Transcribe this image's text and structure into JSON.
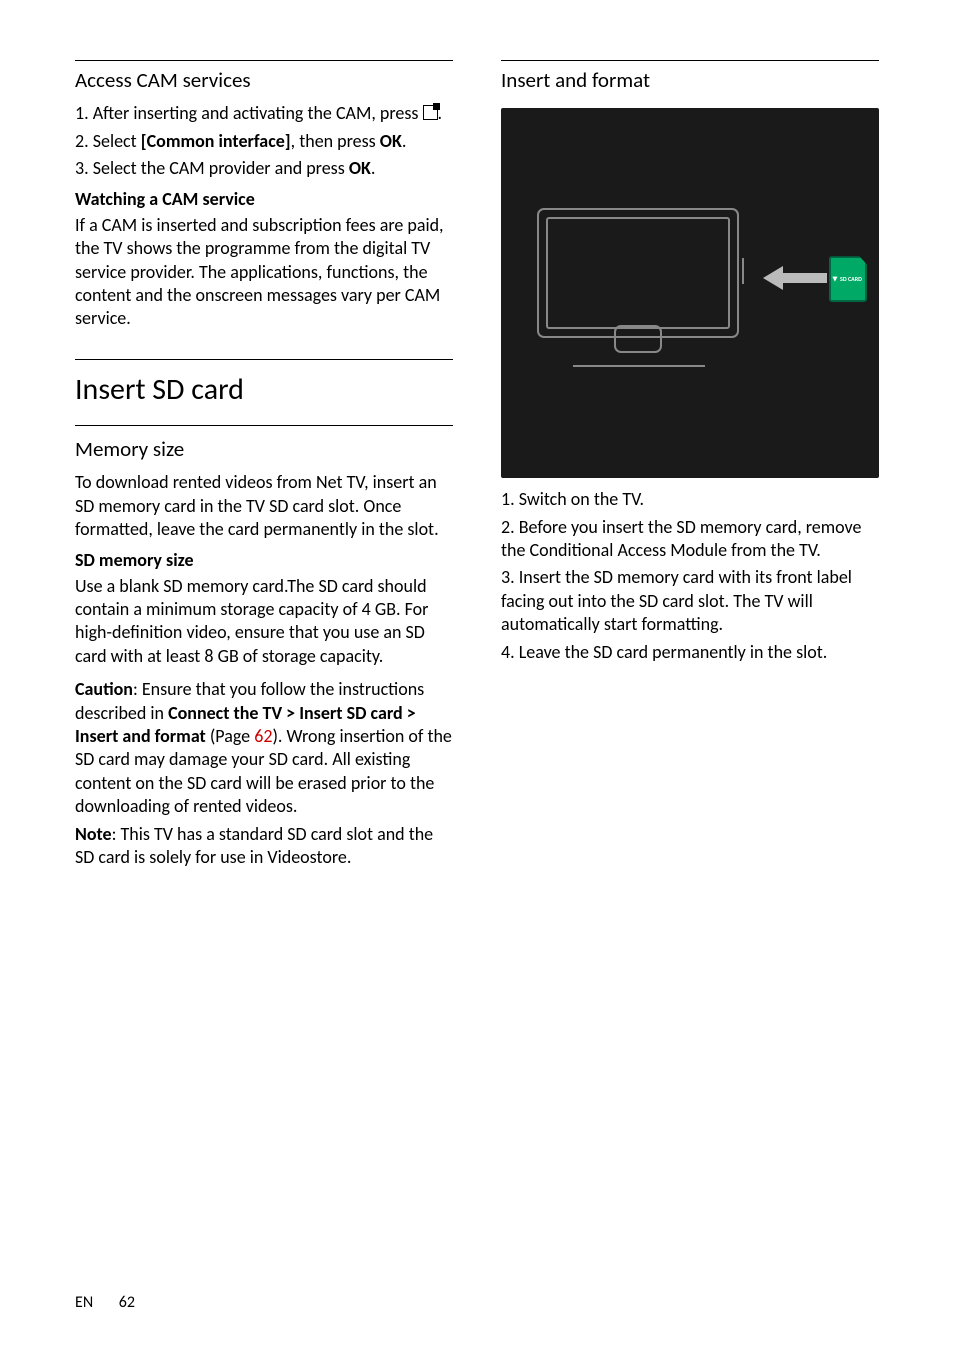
{
  "left": {
    "accessCam": {
      "title": "Access CAM services",
      "step1a": "1. After inserting and activating the CAM, press ",
      "step1b": ".",
      "step2a": "2. Select ",
      "step2b": "[Common interface]",
      "step2c": ", then press ",
      "step2d": "OK",
      "step2e": ".",
      "step3a": "3. Select the CAM provider and press ",
      "step3b": "OK",
      "step3c": "."
    },
    "watching": {
      "title": "Watching a CAM service",
      "body": "If a CAM is inserted and subscription fees are paid, the TV shows the programme from the digital TV service provider. The applications, functions, the content and the onscreen messages vary per CAM service."
    },
    "insertSd": {
      "title": "Insert SD card"
    },
    "memorySize": {
      "title": "Memory size",
      "intro": "To download rented videos from Net TV, insert an SD memory card in the TV SD card slot. Once formatted, leave the card permanently in the slot.",
      "sizeHeading": "SD memory size",
      "sizeBody": "Use a blank SD memory card.The SD card should contain a minimum storage capacity of 4 GB. For high-definition video, ensure that you use an SD card with at least 8 GB of storage capacity.",
      "cautionLabel": "Caution",
      "cautionTextA": ": Ensure that you follow the instructions described in ",
      "cautionPath": "Connect the TV > Insert SD card > Insert and format",
      "cautionTextB": " (Page ",
      "cautionPage": "62",
      "cautionTextC": "). Wrong insertion of the SD card may damage your SD card. All existing content on the SD card will be erased prior to the downloading of rented videos.",
      "noteLabel": "Note",
      "noteText": ": This TV has a standard SD card slot and the SD card is solely for use in Videostore."
    }
  },
  "right": {
    "insertFormat": {
      "title": "Insert and format",
      "sdLabel": "SD CARD",
      "step1": "1. Switch on the TV.",
      "step2": "2. Before you insert the SD memory card, remove the Conditional Access Module from the TV.",
      "step3": "3. Insert the SD memory card with its front label facing out into the SD card slot. The TV will automatically start formatting.",
      "step4": "4. Leave the SD card permanently in the slot."
    }
  },
  "footer": {
    "lang": "EN",
    "page": "62"
  }
}
